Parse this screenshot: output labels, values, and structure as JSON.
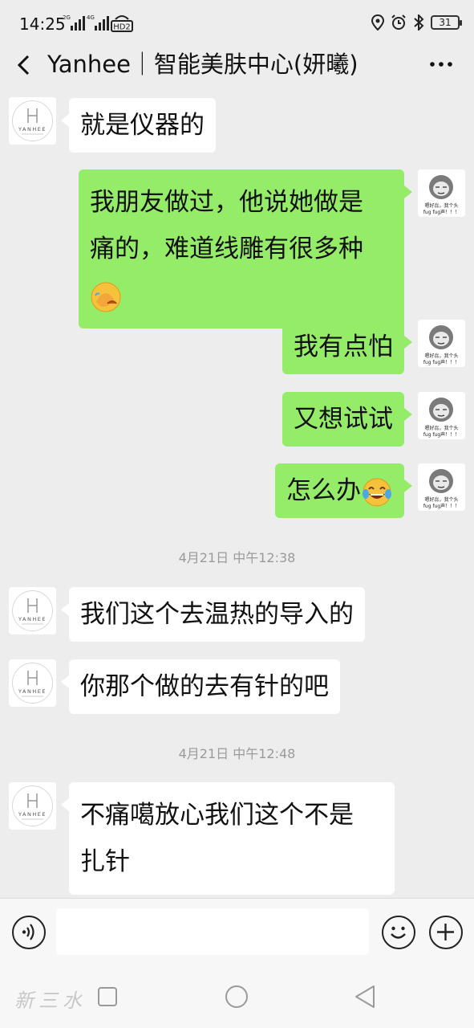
{
  "status_bar": {
    "time": "14:25",
    "sig1_label": "2G",
    "sig2_label": "4G",
    "hd_label": "HD2",
    "battery": "31"
  },
  "header": {
    "title": "Yanhee｜智能美肤中心(妍曦)"
  },
  "contact_avatar_text": "YANHEE",
  "own_avatar_caption": [
    "嗯好惢，我个头",
    "fug fug声！！！"
  ],
  "messages": [
    {
      "side": "in",
      "text": "就是仪器的"
    },
    {
      "side": "out",
      "lines": [
        "我朋友做过，他说她做是",
        "痛的，难道线雕有很多种"
      ],
      "emoji": "facepalm-emoji"
    },
    {
      "side": "out",
      "text": "我有点怕"
    },
    {
      "side": "out",
      "text": "又想试试"
    },
    {
      "side": "out",
      "text": "怎么办",
      "emoji": "tears-of-joy-emoji"
    },
    {
      "side": "in",
      "text": "我们这个去温热的导入的"
    },
    {
      "side": "in",
      "text": "你那个做的去有针的吧"
    },
    {
      "side": "in",
      "lines": [
        "不痛噶放心我们这个不是",
        "扎针"
      ]
    }
  ],
  "timestamps": [
    "4月21日 中午12:38",
    "4月21日 中午12:48"
  ],
  "input": {
    "placeholder": ""
  },
  "nav": {
    "watermark": "新三水"
  },
  "colors": {
    "background": "#ededed",
    "bubble_out": "#95ec69",
    "bubble_in": "#ffffff"
  }
}
